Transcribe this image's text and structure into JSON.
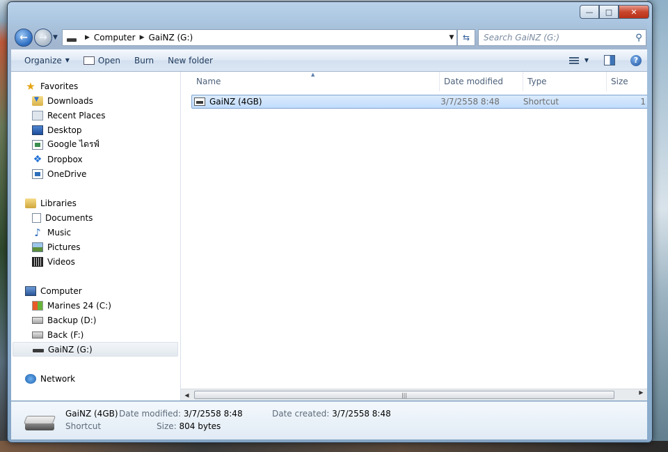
{
  "window": {
    "caption": {
      "minimize": "—",
      "maximize": "□",
      "close": "✕"
    }
  },
  "address": {
    "crumbs": [
      "Computer",
      "GaiNZ (G:)"
    ],
    "search_placeholder": "Search GaiNZ (G:)"
  },
  "toolbar": {
    "organize": "Organize",
    "open": "Open",
    "burn": "Burn",
    "new_folder": "New folder",
    "help": "?"
  },
  "nav": {
    "favorites": {
      "label": "Favorites",
      "items": [
        "Downloads",
        "Recent Places",
        "Desktop",
        "Google ไดรฟ์",
        "Dropbox",
        "OneDrive"
      ]
    },
    "libraries": {
      "label": "Libraries",
      "items": [
        "Documents",
        "Music",
        "Pictures",
        "Videos"
      ]
    },
    "computer": {
      "label": "Computer",
      "items": [
        "Marines 24 (C:)",
        "Backup (D:)",
        "Back (F:)",
        "GaiNZ (G:)"
      ]
    },
    "network": {
      "label": "Network"
    }
  },
  "columns": {
    "name": "Name",
    "date": "Date modified",
    "type": "Type",
    "size": "Size"
  },
  "files": [
    {
      "name": "GaiNZ (4GB)",
      "date": "3/7/2558 8:48",
      "type": "Shortcut",
      "size": "1"
    }
  ],
  "scrollbar": {
    "grip": "|||"
  },
  "details": {
    "name": "GaiNZ (4GB)",
    "type": "Shortcut",
    "date_modified_label": "Date modified:",
    "date_modified": "3/7/2558 8:48",
    "date_created_label": "Date created:",
    "date_created": "3/7/2558 8:48",
    "size_label": "Size:",
    "size": "804 bytes"
  },
  "colors": {
    "accent": "#1e395b",
    "selection": "#c1dcfc"
  }
}
